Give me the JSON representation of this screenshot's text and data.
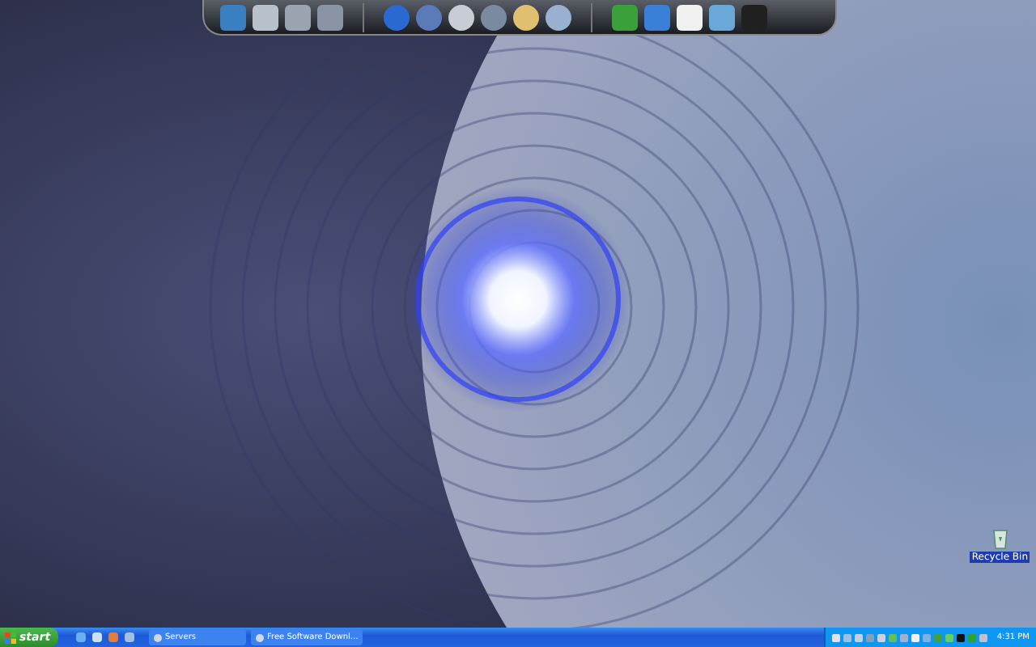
{
  "desktop_icons": [
    {
      "label": "Recycle Bin"
    }
  ],
  "taskbar": {
    "start_button": "start",
    "tasks": [
      {
        "label": "Servers",
        "selected": false
      },
      {
        "label": "Free Software Downl...",
        "selected": false
      }
    ],
    "clock": "4:31 PM"
  }
}
